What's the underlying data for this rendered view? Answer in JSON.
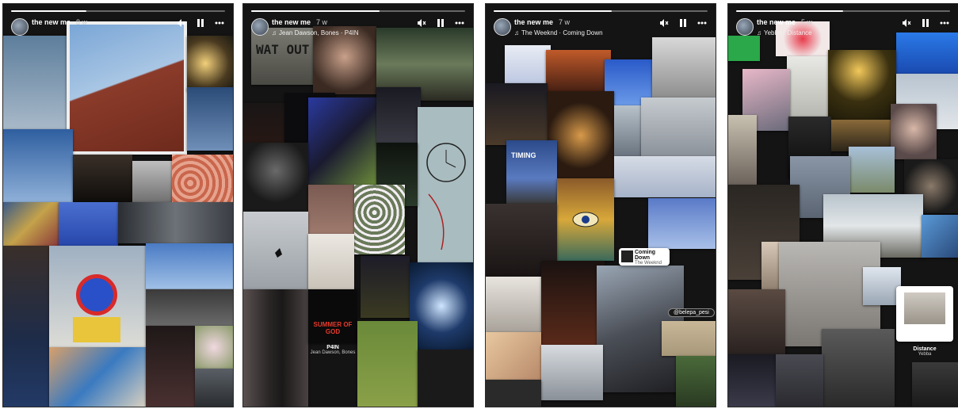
{
  "stories": [
    {
      "username": "the new me",
      "age": "8 w",
      "music": "",
      "progress": 0.35,
      "labels": {
        "music_card_title": "",
        "music_card_artist": ""
      }
    },
    {
      "username": "the new me",
      "age": "7 w",
      "music": "Jean Dawson, Bones · P4IN",
      "progress": 0.6,
      "labels": {
        "sign_text": "WAT OUT",
        "album_text": "SUMMER OF GOD",
        "music_card_title": "P4IN",
        "music_card_artist": "Jean Dawson, Bones"
      }
    },
    {
      "username": "the new me",
      "age": "7 w",
      "music": "The Weeknd · Coming Down",
      "progress": 0.55,
      "labels": {
        "sign_text": "TIMING",
        "music_card_title": "Coming Down",
        "music_card_artist": "The Weeknd",
        "mention": "@belepa_pesi"
      }
    },
    {
      "username": "the new me",
      "age": "5 w",
      "music": "Yebba · Distance",
      "progress": 0.5,
      "labels": {
        "music_card_title": "Distance",
        "music_card_artist": "Yebba"
      }
    }
  ],
  "icons": {
    "mute": "mute-icon",
    "pause": "pause-icon",
    "more": "more-options-icon",
    "music": "music-note-icon"
  },
  "colors": {
    "frame": "#141414",
    "text": "#ffffff"
  }
}
